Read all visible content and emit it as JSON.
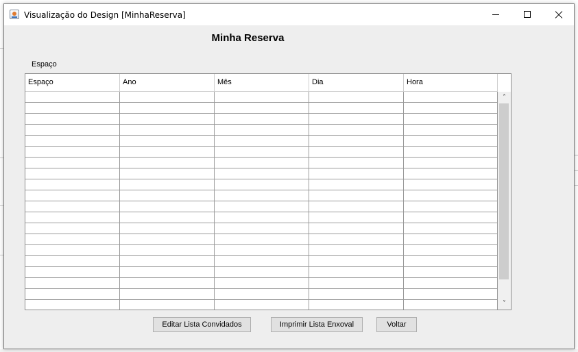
{
  "window": {
    "title": "Visualização do Design [MinhaReserva]"
  },
  "form": {
    "title": "Minha Reserva",
    "section_label": "Espaço"
  },
  "table": {
    "columns": [
      "Espaço",
      "Ano",
      "Mês",
      "Dia",
      "Hora"
    ],
    "rows": [
      [
        "",
        "",
        "",
        "",
        ""
      ],
      [
        "",
        "",
        "",
        "",
        ""
      ],
      [
        "",
        "",
        "",
        "",
        ""
      ],
      [
        "",
        "",
        "",
        "",
        ""
      ],
      [
        "",
        "",
        "",
        "",
        ""
      ],
      [
        "",
        "",
        "",
        "",
        ""
      ],
      [
        "",
        "",
        "",
        "",
        ""
      ],
      [
        "",
        "",
        "",
        "",
        ""
      ],
      [
        "",
        "",
        "",
        "",
        ""
      ],
      [
        "",
        "",
        "",
        "",
        ""
      ],
      [
        "",
        "",
        "",
        "",
        ""
      ],
      [
        "",
        "",
        "",
        "",
        ""
      ],
      [
        "",
        "",
        "",
        "",
        ""
      ],
      [
        "",
        "",
        "",
        "",
        ""
      ],
      [
        "",
        "",
        "",
        "",
        ""
      ],
      [
        "",
        "",
        "",
        "",
        ""
      ],
      [
        "",
        "",
        "",
        "",
        ""
      ],
      [
        "",
        "",
        "",
        "",
        ""
      ],
      [
        "",
        "",
        "",
        "",
        ""
      ],
      [
        "",
        "",
        "",
        "",
        ""
      ]
    ]
  },
  "buttons": {
    "edit_guests": "Editar Lista Convidados",
    "print_trousseau": "Imprimir Lista Enxoval",
    "back": "Voltar"
  },
  "icons": {
    "app": "java-app-icon",
    "minimize": "minimize-icon",
    "maximize": "maximize-icon",
    "close": "close-icon",
    "scroll_up": "chevron-up-icon",
    "scroll_down": "chevron-down-icon"
  },
  "colors": {
    "window_bg": "#eeeeee",
    "titlebar_bg": "#ffffff",
    "button_bg": "#e1e1e1",
    "scroll_thumb": "#cdcdcd"
  }
}
